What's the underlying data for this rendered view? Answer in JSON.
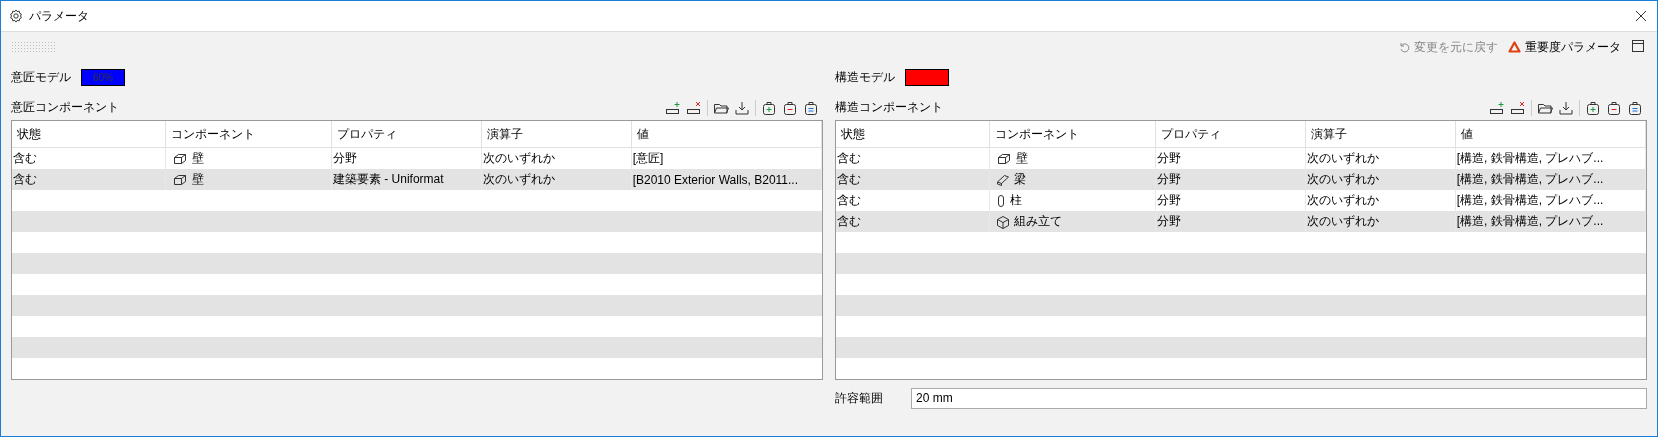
{
  "window": {
    "title": "パラメータ"
  },
  "toolbar": {
    "undo": "変更を元に戻す",
    "importance": "重要度パラメータ"
  },
  "panels": [
    {
      "model_label": "意匠モデル",
      "swatch": {
        "color": "#0000ff",
        "text": "60%"
      },
      "components_label": "意匠コンポーネント",
      "columns": [
        "状態",
        "コンポーネント",
        "プロパティ",
        "演算子",
        "値"
      ],
      "rows": [
        {
          "state": "含む",
          "kind": "wall",
          "component": "壁",
          "property": "分野",
          "operator": "次のいずれか",
          "value": "[意匠]"
        },
        {
          "state": "含む",
          "kind": "wall",
          "component": "壁",
          "property": "建築要素 - Uniformat",
          "operator": "次のいずれか",
          "value": "[B2010 Exterior Walls, B2011..."
        }
      ]
    },
    {
      "model_label": "構造モデル",
      "swatch": {
        "color": "#ff0000"
      },
      "components_label": "構造コンポーネント",
      "columns": [
        "状態",
        "コンポーネント",
        "プロパティ",
        "演算子",
        "値"
      ],
      "rows": [
        {
          "state": "含む",
          "kind": "wall",
          "component": "壁",
          "property": "分野",
          "operator": "次のいずれか",
          "value": "[構造, 鉄骨構造, プレハブ..."
        },
        {
          "state": "含む",
          "kind": "beam",
          "component": "梁",
          "property": "分野",
          "operator": "次のいずれか",
          "value": "[構造, 鉄骨構造, プレハブ..."
        },
        {
          "state": "含む",
          "kind": "column",
          "component": "柱",
          "property": "分野",
          "operator": "次のいずれか",
          "value": "[構造, 鉄骨構造, プレハブ..."
        },
        {
          "state": "含む",
          "kind": "assembly",
          "component": "組み立て",
          "property": "分野",
          "operator": "次のいずれか",
          "value": "[構造, 鉄骨構造, プレハブ..."
        }
      ],
      "tolerance": {
        "label": "許容範囲",
        "value": "20 mm"
      }
    }
  ]
}
